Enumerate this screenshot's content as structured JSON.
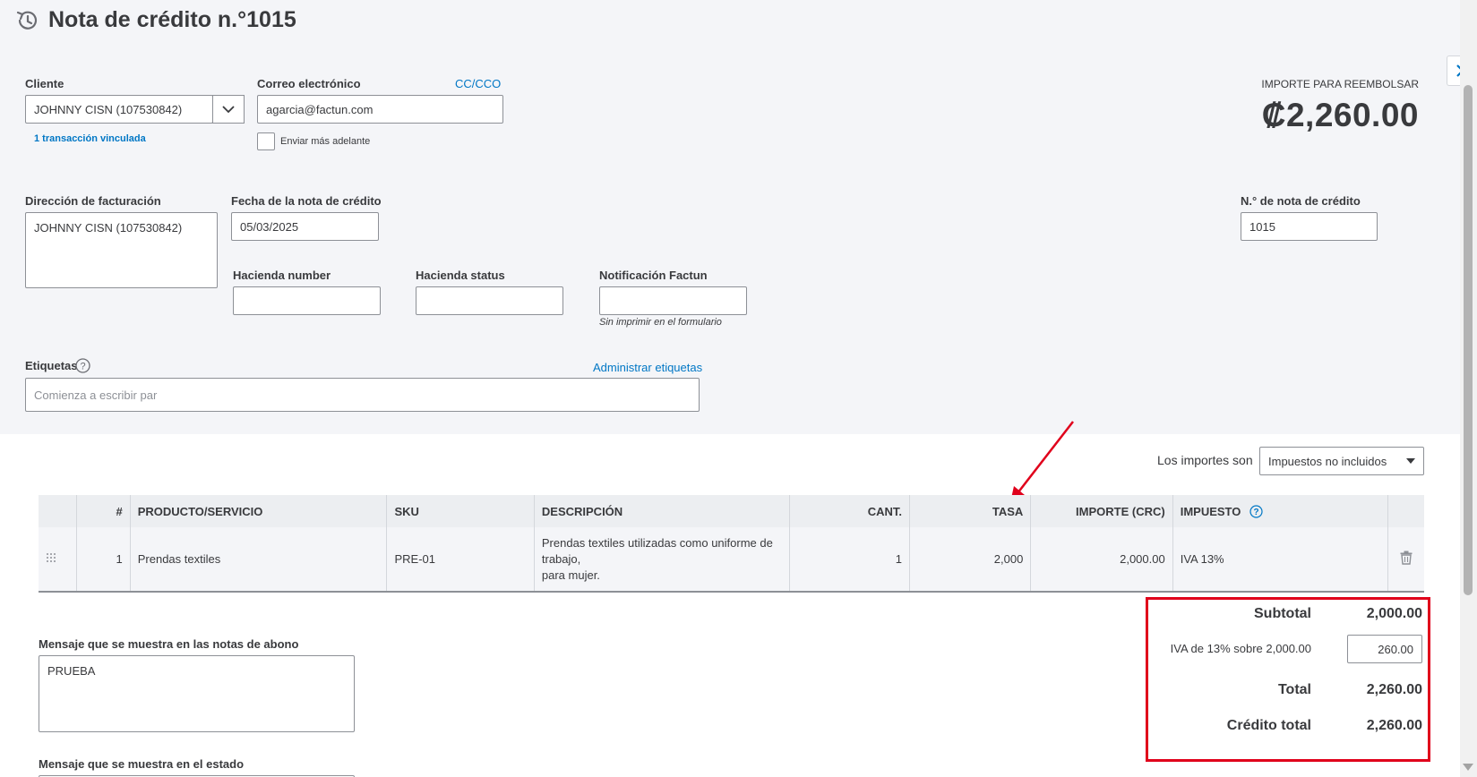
{
  "header": {
    "title": "Nota de crédito n.°1015",
    "refund_label": "IMPORTE PARA REEMBOLSAR",
    "refund_amount": "₡2,260.00"
  },
  "customer": {
    "label": "Cliente",
    "value": "JOHNNY CISN (107530842)",
    "linked_transactions": "1 transacción vinculada"
  },
  "email": {
    "label": "Correo electrónico",
    "cc_link": "CC/CCO",
    "value": "agarcia@factun.com",
    "send_later_label": "Enviar más adelante",
    "send_later_checked": false
  },
  "billing_address": {
    "label": "Dirección de facturación",
    "value": "JOHNNY CISN (107530842)"
  },
  "credit_note_date": {
    "label": "Fecha de la nota de crédito",
    "value": "05/03/2025"
  },
  "credit_note_number": {
    "label": "N.° de nota de crédito",
    "value": "1015"
  },
  "custom_fields": {
    "hacienda_number_label": "Hacienda number",
    "hacienda_number_value": "",
    "hacienda_status_label": "Hacienda status",
    "hacienda_status_value": "",
    "notificacion_label": "Notificación Factun",
    "notificacion_value": "",
    "notificacion_hint": "Sin imprimir en el formulario"
  },
  "tags": {
    "label": "Etiquetas",
    "manage_link": "Administrar etiquetas",
    "placeholder": "Comienza a escribir par"
  },
  "amounts_are": {
    "label": "Los importes son",
    "selected": "Impuestos no incluidos"
  },
  "table": {
    "headers": {
      "num": "#",
      "product": "PRODUCTO/SERVICIO",
      "sku": "SKU",
      "description": "DESCRIPCIÓN",
      "qty": "CANT.",
      "rate": "TASA",
      "amount": "IMPORTE (CRC)",
      "tax": "IMPUESTO"
    },
    "rows": [
      {
        "num": "1",
        "product": "Prendas textiles",
        "sku": "PRE-01",
        "description_line1": "Prendas textiles utilizadas como uniforme de",
        "description_line2": "trabajo,",
        "description_line3": "para mujer.",
        "qty": "1",
        "rate": "2,000",
        "amount": "2,000.00",
        "tax": "IVA 13%"
      }
    ]
  },
  "messages": {
    "credit_note_label": "Mensaje que se muestra en las notas de abono",
    "credit_note_value": "PRUEBA",
    "statement_label": "Mensaje que se muestra en el estado"
  },
  "totals": {
    "subtotal_label": "Subtotal",
    "subtotal_value": "2,000.00",
    "tax_label": "IVA de 13% sobre 2,000.00",
    "tax_value": "260.00",
    "total_label": "Total",
    "total_value": "2,260.00",
    "credit_total_label": "Crédito total",
    "credit_total_value": "2,260.00"
  },
  "colors": {
    "link": "#0077c5",
    "highlight": "#e0001b",
    "panel": "#f4f5f8"
  }
}
